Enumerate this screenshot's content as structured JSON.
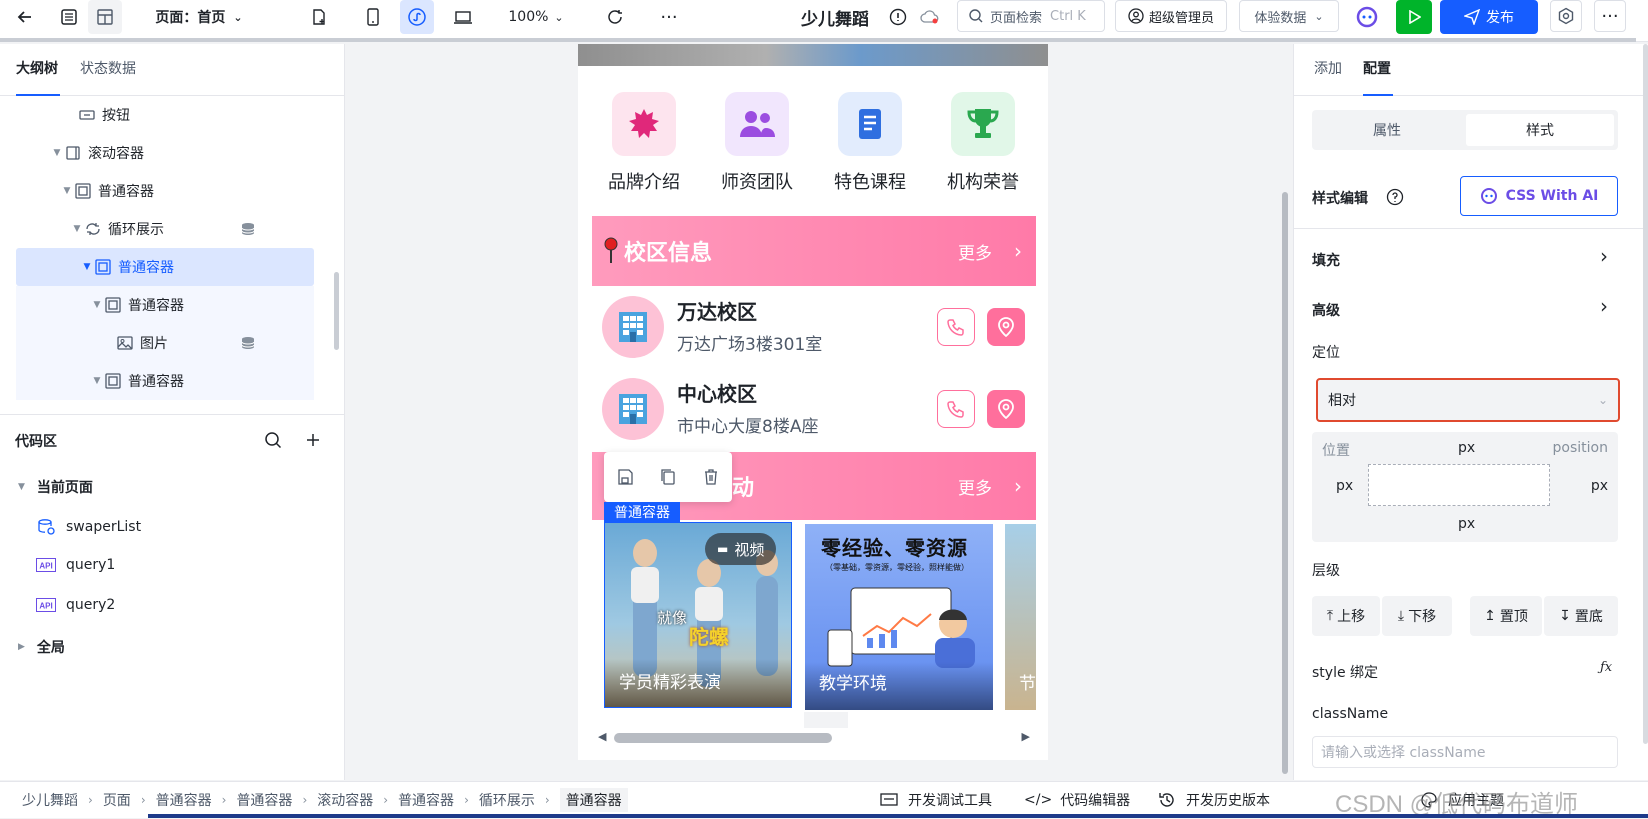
{
  "topbar": {
    "page_label": "页面：首页",
    "zoom": "100%",
    "app_name": "少儿舞蹈",
    "search_placeholder": "页面检索",
    "search_shortcut": "Ctrl K",
    "user_role": "超级管理员",
    "data_mode": "体验数据",
    "publish": "发布"
  },
  "left": {
    "tabs": [
      "大纲树",
      "状态数据"
    ],
    "tree": [
      {
        "label": "按钮",
        "icon": "button-icon",
        "indent": 1
      },
      {
        "label": "滚动容器",
        "icon": "scroll-container-icon",
        "indent": 0
      },
      {
        "label": "普通容器",
        "icon": "container-icon",
        "indent": 1
      },
      {
        "label": "循环展示",
        "icon": "loop-icon",
        "indent": 2
      },
      {
        "label": "普通容器",
        "icon": "container-icon",
        "indent": 3
      },
      {
        "label": "普通容器",
        "icon": "container-icon",
        "indent": 4
      },
      {
        "label": "图片",
        "icon": "image-icon",
        "indent": 5
      },
      {
        "label": "普通容器",
        "icon": "container-icon",
        "indent": 4
      }
    ],
    "code_title": "代码区",
    "current_page": "当前页面",
    "code_items": [
      "swaperList",
      "query1",
      "query2"
    ],
    "global": "全局"
  },
  "phone": {
    "icons": [
      {
        "label": "品牌介绍",
        "bg": "#fde4ee",
        "color": "#e0287a"
      },
      {
        "label": "师资团队",
        "bg": "#f1e6fd",
        "color": "#9b4de0"
      },
      {
        "label": "特色课程",
        "bg": "#e2ecfd",
        "color": "#2f6fe0"
      },
      {
        "label": "机构荣誉",
        "bg": "#e1f7e8",
        "color": "#2aa84f"
      }
    ],
    "campus_title": "校区信息",
    "more": "更多",
    "campuses": [
      {
        "name": "万达校区",
        "addr": "万达广场3楼301室"
      },
      {
        "name": "中心校区",
        "addr": "市中心大厦8楼A座"
      }
    ],
    "activity_title_tail": "动",
    "selected_tag": "普通容器",
    "cards": [
      {
        "caption": "学员精彩表演",
        "badge": "视频",
        "overlay": "就像",
        "overlay2": "陀螺"
      },
      {
        "caption": "教学环境",
        "headline": "零经验、零资源",
        "sub": "（零基础，零资源，零经验，照样能做）"
      },
      {
        "caption": "节"
      }
    ]
  },
  "right": {
    "tabs": [
      "添加",
      "配置"
    ],
    "seg": [
      "属性",
      "样式"
    ],
    "style_edit": "样式编辑",
    "ai_btn": "CSS With AI",
    "fill": "填充",
    "advanced": "高级",
    "positioning": "定位",
    "position_value": "相对",
    "pos_label": "位置",
    "pos_prop": "position",
    "px": "px",
    "layer": "层级",
    "layer_btns": [
      "上移",
      "下移",
      "置顶",
      "置底"
    ],
    "style_bind": "style 绑定",
    "classname": "className",
    "classname_placeholder": "请输入或选择 className"
  },
  "breadcrumb": {
    "items": [
      "少儿舞蹈",
      "页面",
      "普通容器",
      "普通容器",
      "滚动容器",
      "普通容器",
      "循环展示",
      "普通容器"
    ],
    "tools": [
      "开发调试工具",
      "代码编辑器",
      "开发历史版本",
      "应用主题"
    ]
  },
  "watermark": "CSDN @低代码布道师",
  "colors": {
    "primary": "#165dff",
    "pink": "#ff6f9c",
    "run": "#00b42a"
  }
}
